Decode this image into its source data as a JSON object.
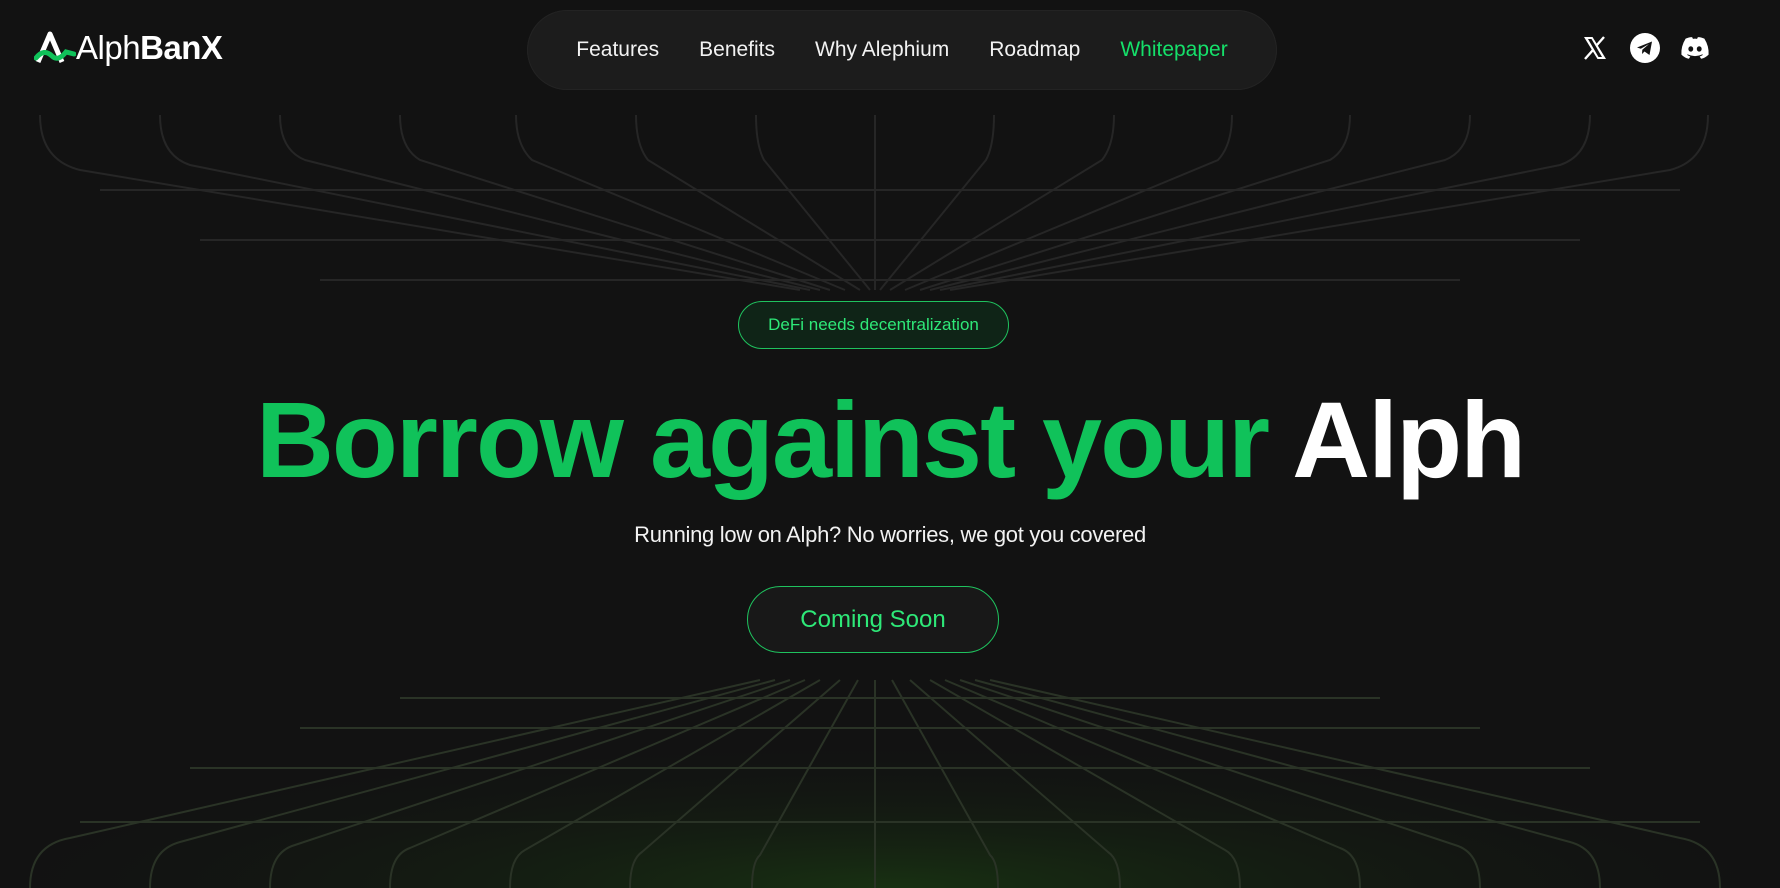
{
  "brand": {
    "name_light": "Alph",
    "name_bold": "BanX",
    "accent": "#10c25a"
  },
  "nav": {
    "items": [
      {
        "label": "Features"
      },
      {
        "label": "Benefits"
      },
      {
        "label": "Why Alephium"
      },
      {
        "label": "Roadmap"
      },
      {
        "label": "Whitepaper",
        "highlighted": true
      }
    ]
  },
  "socials": [
    {
      "icon": "x-icon"
    },
    {
      "icon": "telegram-icon"
    },
    {
      "icon": "discord-icon"
    }
  ],
  "hero": {
    "badge": "DeFi needs decentralization",
    "headline_green": "Borrow against your",
    "headline_white": "Alph",
    "subtitle": "Running low on Alph? No worries, we got you covered",
    "cta": "Coming Soon"
  }
}
